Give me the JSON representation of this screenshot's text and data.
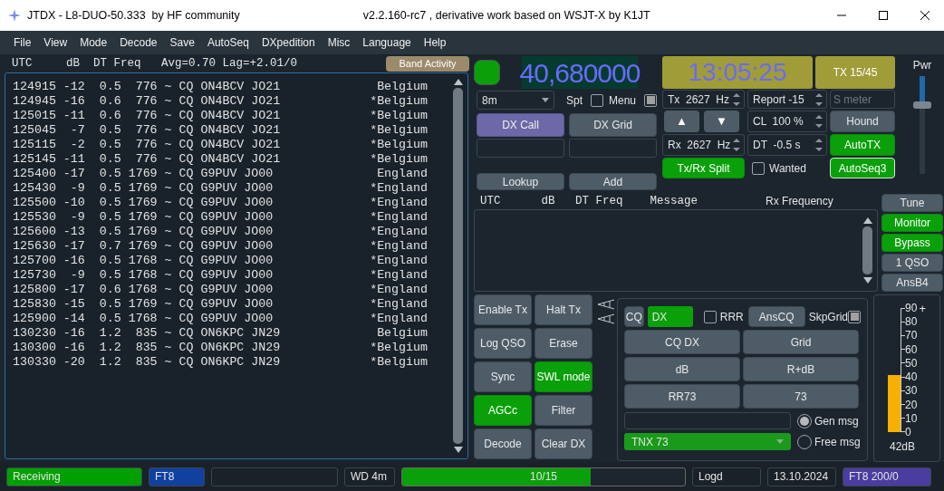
{
  "window": {
    "title": "JTDX - L8-DUO-50.333  by HF community",
    "version": "v2.2.160-rc7 , derivative work based on WSJT-X by K1JT"
  },
  "menu": [
    "File",
    "View",
    "Mode",
    "Decode",
    "Save",
    "AutoSeq",
    "DXpedition",
    "Misc",
    "Language",
    "Help"
  ],
  "band_activity": {
    "header": "UTC     dB  DT Freq   Avg=0.70 Lag=+2.01/0",
    "button": "Band Activity",
    "rows": [
      {
        "message": "124915 -12  0.5  776 ~ CQ ON4BCV JO21",
        "country": "Belgium"
      },
      {
        "message": "124945 -16  0.6  776 ~ CQ ON4BCV JO21",
        "country": "*Belgium"
      },
      {
        "message": "125015 -11  0.6  776 ~ CQ ON4BCV JO21",
        "country": "*Belgium"
      },
      {
        "message": "125045  -7  0.5  776 ~ CQ ON4BCV JO21",
        "country": "*Belgium"
      },
      {
        "message": "125115  -2  0.5  776 ~ CQ ON4BCV JO21",
        "country": "*Belgium"
      },
      {
        "message": "125145 -11  0.5  776 ~ CQ ON4BCV JO21",
        "country": "*Belgium"
      },
      {
        "message": "125400 -17  0.5 1769 ~ CQ G9PUV JO00",
        "country": "England"
      },
      {
        "message": "125430  -9  0.5 1769 ~ CQ G9PUV JO00",
        "country": "*England"
      },
      {
        "message": "125500 -10  0.5 1769 ~ CQ G9PUV JO00",
        "country": "*England"
      },
      {
        "message": "125530  -9  0.5 1769 ~ CQ G9PUV JO00",
        "country": "*England"
      },
      {
        "message": "125600 -13  0.5 1769 ~ CQ G9PUV JO00",
        "country": "*England"
      },
      {
        "message": "125630 -17  0.7 1769 ~ CQ G9PUV JO00",
        "country": "*England"
      },
      {
        "message": "125700 -16  0.5 1768 ~ CQ G9PUV JO00",
        "country": "*England"
      },
      {
        "message": "125730  -9  0.5 1768 ~ CQ G9PUV JO00",
        "country": "*England"
      },
      {
        "message": "125800 -17  0.6 1768 ~ CQ G9PUV JO00",
        "country": "*England"
      },
      {
        "message": "125830 -15  0.5 1769 ~ CQ G9PUV JO00",
        "country": "*England"
      },
      {
        "message": "125900 -14  0.5 1768 ~ CQ G9PUV JO00",
        "country": "*England"
      },
      {
        "message": "130230 -16  1.2  835 ~ CQ ON6KPC JN29",
        "country": "Belgium"
      },
      {
        "message": "130300 -16  1.2  835 ~ CQ ON6KPC JN29",
        "country": "*Belgium"
      },
      {
        "message": "130330 -20  1.2  835 ~ CQ ON6KPC JN29",
        "country": "*Belgium"
      }
    ]
  },
  "radio": {
    "led_on": true,
    "frequency": "40,680000",
    "band": "8m",
    "spt": {
      "label": "Spt",
      "checked": false
    },
    "menu_toggle": {
      "label": "Menu",
      "checked": true
    }
  },
  "dx": {
    "buttons": [
      {
        "label": "DX Call",
        "highlighted": true
      },
      {
        "label": "DX Grid",
        "highlighted": false
      }
    ],
    "lookup": "Lookup",
    "add": "Add"
  },
  "clock": "13:05:25",
  "tx_period": "TX 15/45",
  "controls": [
    {
      "kind": "spin",
      "label": "Tx  2627  Hz"
    },
    {
      "kind": "spin",
      "label": "Report -15"
    },
    {
      "kind": "field",
      "placeholder": "S meter"
    },
    {
      "kind": "arrows",
      "labels": [
        "▲",
        "▼"
      ]
    },
    {
      "kind": "spin",
      "label": "CL  100 %"
    },
    {
      "kind": "button",
      "label": "Hound",
      "on": false
    },
    {
      "kind": "spin",
      "label": "Rx  2627  Hz"
    },
    {
      "kind": "spin",
      "label": "DT  -0.5 s"
    },
    {
      "kind": "button",
      "label": "AutoTX",
      "on": true
    },
    {
      "kind": "button",
      "label": "Tx/Rx Split",
      "on": true
    },
    {
      "kind": "check",
      "label": "Wanted",
      "checked": false
    },
    {
      "kind": "button",
      "label": "AutoSeq3",
      "on": true,
      "focused": true
    }
  ],
  "power": {
    "label": "Pwr",
    "level": 0.72
  },
  "rx_window": {
    "header": "UTC      dB   DT Freq    Message",
    "title": "Rx Frequency"
  },
  "side_buttons": [
    {
      "label": "Tune",
      "on": false
    },
    {
      "label": "Monitor",
      "on": true
    },
    {
      "label": "Bypass",
      "on": true
    },
    {
      "label": "1 QSO",
      "on": false
    },
    {
      "label": "AnsB4",
      "on": false
    }
  ],
  "main_buttons": [
    {
      "label": "Enable Tx",
      "on": false
    },
    {
      "label": "Halt Tx",
      "on": false
    },
    {
      "label": "Log QSO",
      "on": false
    },
    {
      "label": "Erase",
      "on": false
    },
    {
      "label": "Sync",
      "on": false
    },
    {
      "label": "SWL mode",
      "on": true
    },
    {
      "label": "AGCc",
      "on": true
    },
    {
      "label": "Filter",
      "on": false
    },
    {
      "label": "Decode",
      "on": false
    },
    {
      "label": "Clear DX",
      "on": false
    }
  ],
  "tx_messages": {
    "cq": "CQ",
    "dx": {
      "label": "DX",
      "on": true
    },
    "rrr": {
      "label": "RRR",
      "checked": false
    },
    "anscq": "AnsCQ",
    "skpgrid": {
      "label": "SkpGrid",
      "checked": true
    },
    "buttons": [
      "CQ DX",
      "Grid",
      "dB",
      "R+dB",
      "RR73",
      "73"
    ],
    "free_text": "TNX 73",
    "modes": [
      {
        "label": "Gen msg",
        "selected": true
      },
      {
        "label": "Free msg",
        "selected": false
      }
    ]
  },
  "signal_meter": {
    "ticks": [
      "90",
      "80",
      "70",
      "60",
      "50",
      "40",
      "30",
      "20",
      "10",
      "0"
    ],
    "plus": "+",
    "level": 0.467,
    "reading": "42dB"
  },
  "status_bar": [
    {
      "kind": "state",
      "text": "Receiving",
      "color": "#00a000"
    },
    {
      "kind": "mode",
      "text": "FT8",
      "color": "#1040a0"
    },
    {
      "kind": "empty"
    },
    {
      "kind": "plain",
      "text": "WD 4m"
    },
    {
      "kind": "progress",
      "text": "10/15",
      "level": 0.667
    },
    {
      "kind": "plain",
      "text": "Logd"
    },
    {
      "kind": "plain",
      "text": "13.10.2024"
    },
    {
      "kind": "mode",
      "text": "FT8  200/0",
      "color": "#4a3ca0"
    }
  ]
}
